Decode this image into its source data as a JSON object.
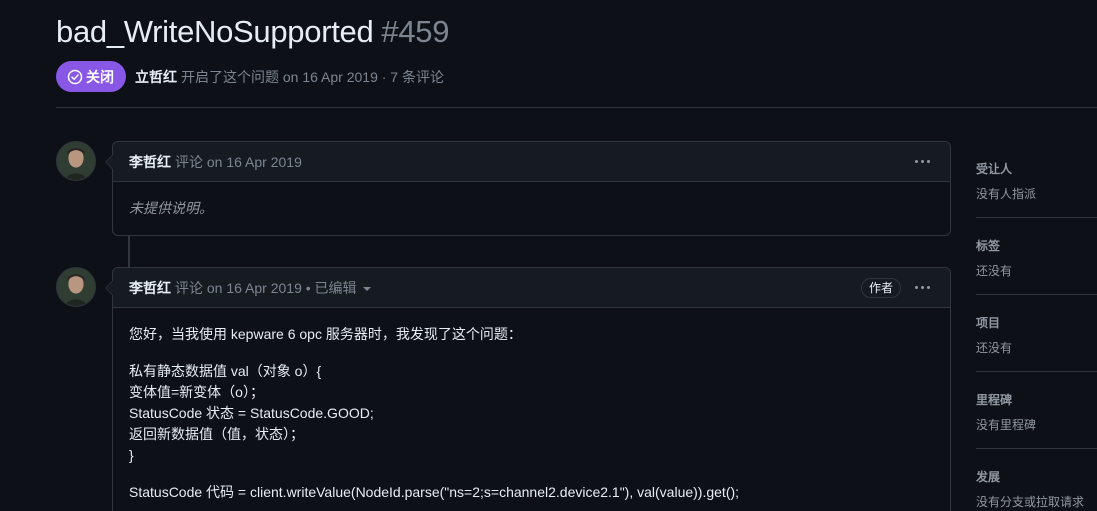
{
  "issue": {
    "title": "bad_WriteNoSupported",
    "number": "#459",
    "state_label": "关闭",
    "author": "立哲红",
    "opened_text": "开启了这个问题 on 16 Apr 2019 · 7 条评论"
  },
  "comments": [
    {
      "author": "李哲红",
      "meta": "评论 on 16 Apr 2019",
      "body": "未提供说明。"
    },
    {
      "author": "李哲红",
      "meta": "评论 on 16 Apr 2019 • 已编辑",
      "author_badge": "作者",
      "body_lines": [
        "您好，当我使用 kepware 6 opc 服务器时，我发现了这个问题：",
        "私有静态数据值 val（对象 o）{",
        "变体值=新变体（o）；",
        "StatusCode 状态 = StatusCode.GOOD;",
        "返回新数据值（值，状态）；",
        "}",
        "StatusCode 代码 = client.writeValue(NodeId.parse(\"ns=2;s=channel2.device2.1\"), val(value)).get();"
      ]
    }
  ],
  "sidebar": [
    {
      "heading": "受让人",
      "value": "没有人指派"
    },
    {
      "heading": "标签",
      "value": "还没有"
    },
    {
      "heading": "项目",
      "value": "还没有"
    },
    {
      "heading": "里程碑",
      "value": "没有里程碑"
    },
    {
      "heading": "发展",
      "value": "没有分支或拉取请求"
    }
  ],
  "colors": {
    "background": "#0d1117",
    "closed_badge": "#8957e5",
    "border": "#30363d",
    "muted_text": "#7d8590"
  }
}
